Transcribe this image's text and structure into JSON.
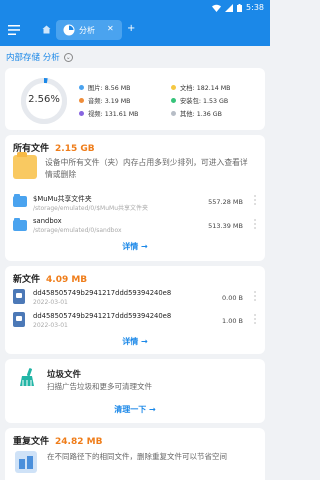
{
  "status": {
    "time": "5:38"
  },
  "app": {
    "tab_label": "分析"
  },
  "breadcrumb": {
    "label": "内部存储 分析"
  },
  "storage": {
    "percent_label": "2.56%",
    "used_fraction": 0.0256,
    "legend": [
      {
        "label": "图片: 8.56 MB",
        "color": "#4aa3ef"
      },
      {
        "label": "文档: 182.14 MB",
        "color": "#f5c843"
      },
      {
        "label": "音频: 3.19 MB",
        "color": "#ef8d3a"
      },
      {
        "label": "安装包: 1.53 GB",
        "color": "#36c37a"
      },
      {
        "label": "视频: 131.61 MB",
        "color": "#8765e0"
      },
      {
        "label": "其他: 1.36 GB",
        "color": "#b7bdc6"
      }
    ]
  },
  "all_files": {
    "title": "所有文件",
    "size": "2.15 GB",
    "intro": "设备中所有文件（夹）内存占用多到少排列，可进入查看详情或删除",
    "items": [
      {
        "name": "$MuMu共享文件夹",
        "path": "/storage/emulated/0/$MuMu共享文件夹",
        "size": "557.28 MB"
      },
      {
        "name": "sandbox",
        "path": "/storage/emulated/0/sandbox",
        "size": "513.39 MB"
      }
    ],
    "link": "详情 →"
  },
  "new_files": {
    "title": "新文件",
    "size": "4.09 MB",
    "items": [
      {
        "name": "dd458505749b2941217ddd59394240e8",
        "date": "2022-03-01",
        "size": "0.00 B"
      },
      {
        "name": "dd458505749b2941217ddd59394240e8",
        "date": "2022-03-01",
        "size": "1.00 B"
      }
    ],
    "link": "详情 →"
  },
  "junk": {
    "title": "垃圾文件",
    "desc": "扫描广告垃圾和更多可清理文件",
    "link": "清理一下 →"
  },
  "duplicates": {
    "title": "重复文件",
    "size": "24.82 MB",
    "desc": "在不同路径下的相同文件，删除重复文件可以节省空间"
  }
}
